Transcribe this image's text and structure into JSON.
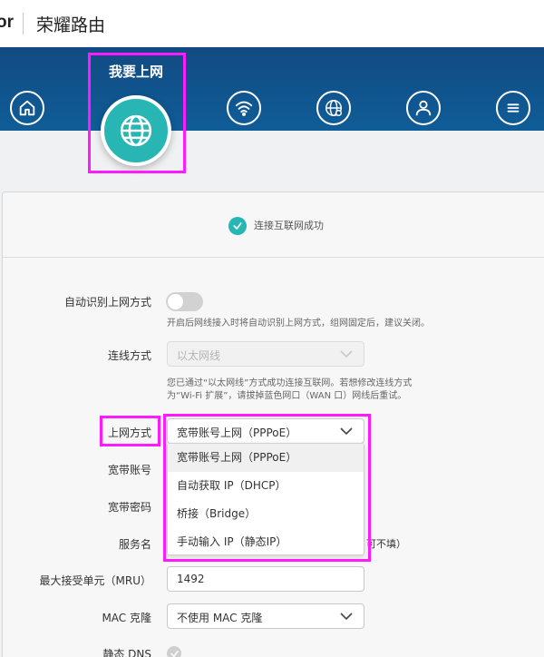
{
  "header": {
    "brand_fragment": "or",
    "title": "荣耀路由"
  },
  "nav": {
    "active_label": "我要上网",
    "items": [
      {
        "icon": "home-icon"
      },
      {
        "icon": "globe-icon"
      },
      {
        "icon": "wifi-icon"
      },
      {
        "icon": "globe-settings-icon"
      },
      {
        "icon": "user-icon"
      },
      {
        "icon": "menu-icon"
      }
    ]
  },
  "status": {
    "text": "连接互联网成功"
  },
  "form": {
    "auto_detect": {
      "label": "自动识别上网方式",
      "enabled": false,
      "hint": "开启后网线接入时将自动识别上网方式，组网固定后，建议关闭。"
    },
    "connection_mode": {
      "label": "连线方式",
      "value": "以太网线",
      "hint_line1": "您已通过“以太网线”方式成功连接互联网。若想修改连线方式",
      "hint_line2": "为“Wi-Fi 扩展”，请拔掉蓝色网口（WAN 口）网线后重试。"
    },
    "internet_mode": {
      "label": "上网方式",
      "value": "宽带账号上网（PPPoE）",
      "options": [
        "宽带账号上网（PPPoE）",
        "自动获取 IP（DHCP）",
        "桥接（Bridge）",
        "手动输入 IP（静态IP）"
      ]
    },
    "broadband_account": {
      "label": "宽带账号"
    },
    "broadband_password": {
      "label": "宽带密码"
    },
    "service_name": {
      "label": "服务名",
      "note": "可不填）"
    },
    "mru": {
      "label": "最大接受单元（MRU）",
      "value": "1492"
    },
    "mac_clone": {
      "label": "MAC 克隆",
      "value": "不使用 MAC 克隆"
    },
    "static_dns": {
      "label": "静态 DNS"
    }
  },
  "colors": {
    "accent": "#27b6b3",
    "nav_bg": "#124a82",
    "highlight": "#ff1aff"
  }
}
